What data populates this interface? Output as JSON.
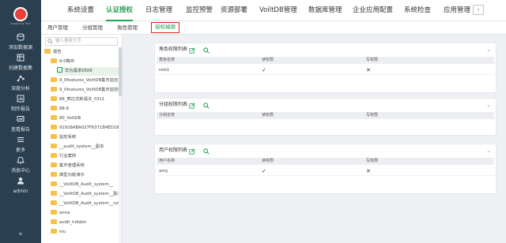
{
  "logo": {
    "text": "Yonghong Tech"
  },
  "nav": [
    {
      "label": "添加数据源",
      "icon": "database-icon"
    },
    {
      "label": "创建数据集",
      "icon": "dataset-icon"
    },
    {
      "label": "深度分析",
      "icon": "analysis-icon"
    },
    {
      "label": "制作报告",
      "icon": "report-icon"
    },
    {
      "label": "查看报告",
      "icon": "view-report-icon"
    },
    {
      "label": "更多",
      "icon": "more-icon"
    },
    {
      "label": "消息中心",
      "icon": "message-icon"
    },
    {
      "label": "admin",
      "icon": "user-icon"
    }
  ],
  "nav_collapse": "«",
  "modules": [
    "系统设置",
    "认证授权",
    "日志管理",
    "监控预警",
    "资源部署",
    "VoiltDB管理",
    "数据库管理",
    "企业应用配置",
    "系统检查",
    "应用管理"
  ],
  "active_module": "认证授权",
  "more_btn": "›",
  "subtabs": [
    "用户管理",
    "分组管理",
    "角色管理",
    "授权编辑"
  ],
  "active_subtab": "授权编辑",
  "search_placeholder": "输入搜索文字",
  "tree": [
    {
      "label": "报告",
      "level": 0,
      "type": "folder"
    },
    {
      "label": "9-0略布",
      "level": 1,
      "type": "folder"
    },
    {
      "label": "华为需求0509",
      "level": 2,
      "type": "doc",
      "selected": true
    },
    {
      "label": "9_0features_VoiltDB集市监控",
      "level": 1,
      "type": "folder"
    },
    {
      "label": "9_0features_VoiltDB集市监控C",
      "level": 1,
      "type": "folder"
    },
    {
      "label": "88_表达式新语法_0311",
      "level": 1,
      "type": "folder"
    },
    {
      "label": "88-8",
      "level": 1,
      "type": "folder"
    },
    {
      "label": "90_VoltDB",
      "level": 1,
      "type": "folder"
    },
    {
      "label": "91928ABA027F6371B4ED18A5",
      "level": 1,
      "type": "folder"
    },
    {
      "label": "监控系统",
      "level": 1,
      "type": "folder"
    },
    {
      "label": "__audit_system__副本",
      "level": 1,
      "type": "folder"
    },
    {
      "label": "行业案例",
      "level": 1,
      "type": "folder"
    },
    {
      "label": "集市管理系统",
      "level": 1,
      "type": "folder"
    },
    {
      "label": "典型功能演示",
      "level": 1,
      "type": "folder"
    },
    {
      "label": "__VoiltDB_Audit_system__",
      "level": 1,
      "type": "folder"
    },
    {
      "label": "__VoiltDB_Audit_system__副本",
      "level": 1,
      "type": "folder"
    },
    {
      "label": "__VoiltDB_Audit_system__celin",
      "level": 1,
      "type": "folder"
    },
    {
      "label": "anna",
      "level": 1,
      "type": "folder"
    },
    {
      "label": "audit_hidden",
      "level": 1,
      "type": "folder"
    },
    {
      "label": "niu",
      "level": 1,
      "type": "folder"
    }
  ],
  "role_card": {
    "title": "角色权限列表",
    "headers": [
      "角色名称",
      "读权限",
      "写权限"
    ],
    "rows": [
      {
        "name": "role1",
        "read": "✓",
        "write": "✕"
      }
    ]
  },
  "group_card": {
    "title": "分组权限列表",
    "headers": [
      "分组名称",
      "读权限",
      "写权限"
    ],
    "rows": []
  },
  "user_card": {
    "title": "用户权限列表",
    "headers": [
      "用户名称",
      "读权限",
      "写权限"
    ],
    "rows": [
      {
        "name": "amy",
        "read": "✓",
        "write": "✕"
      }
    ]
  },
  "colors": {
    "sidebar": "#2a3f4f",
    "accent": "#26a255",
    "highlight_border": "#e02020"
  }
}
